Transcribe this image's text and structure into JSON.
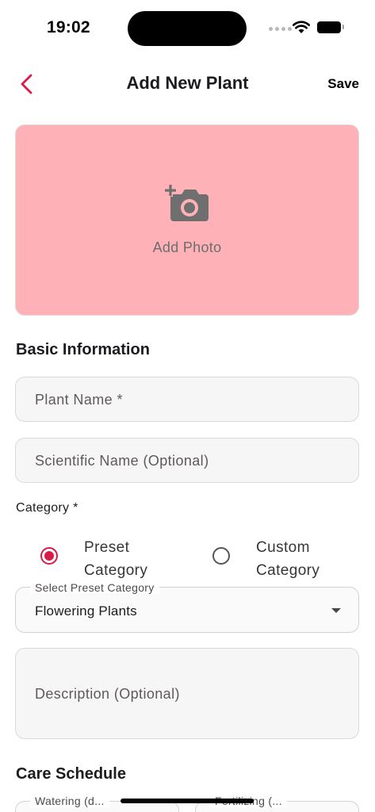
{
  "status_bar": {
    "time": "19:02"
  },
  "app_bar": {
    "title": "Add New Plant",
    "save_label": "Save"
  },
  "photo": {
    "label": "Add Photo"
  },
  "basic_info": {
    "title": "Basic Information",
    "plant_name_placeholder": "Plant Name *",
    "scientific_name_placeholder": "Scientific Name (Optional)"
  },
  "category": {
    "label": "Category *",
    "options": [
      {
        "label": "Preset Category",
        "selected": true
      },
      {
        "label": "Custom Category",
        "selected": false
      }
    ],
    "preset_select_label": "Select Preset Category",
    "preset_select_value": "Flowering Plants"
  },
  "description": {
    "placeholder": "Description (Optional)"
  },
  "care_schedule": {
    "title": "Care Schedule",
    "watering_label": "Watering (d...",
    "fertilizing_label": "Fertilizing (..."
  },
  "colors": {
    "accent": "#d81b48",
    "photo_background": "#ffb1b8"
  }
}
